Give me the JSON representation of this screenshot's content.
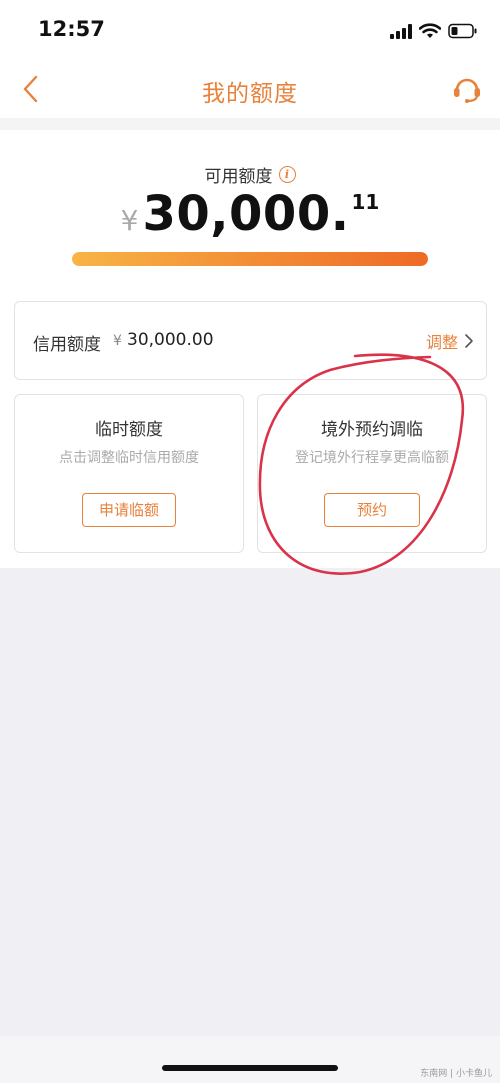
{
  "status_bar": {
    "time": "12:57",
    "icons": [
      "signal-icon",
      "wifi-icon",
      "battery-icon"
    ]
  },
  "nav": {
    "title": "我的额度",
    "back_icon": "chevron-left-icon",
    "service_icon": "headset-icon"
  },
  "available": {
    "label": "可用额度",
    "currency": "¥",
    "amount": "30,000.",
    "cents": "11",
    "usage_fraction": 1.0
  },
  "credit_limit": {
    "label": "信用额度",
    "currency": "¥",
    "value": "30,000.00",
    "action_label": "调整"
  },
  "options": [
    {
      "title": "临时额度",
      "description": "点击调整临时信用额度",
      "button_label": "申请临额"
    },
    {
      "title": "境外预约调临",
      "description": "登记境外行程享更高临额",
      "button_label": "预约"
    }
  ],
  "watermark": "东南网 | 小卡鱼儿",
  "colors": {
    "accent": "#e8813a",
    "annotation": "#d9334a",
    "background": "#efeff4"
  }
}
